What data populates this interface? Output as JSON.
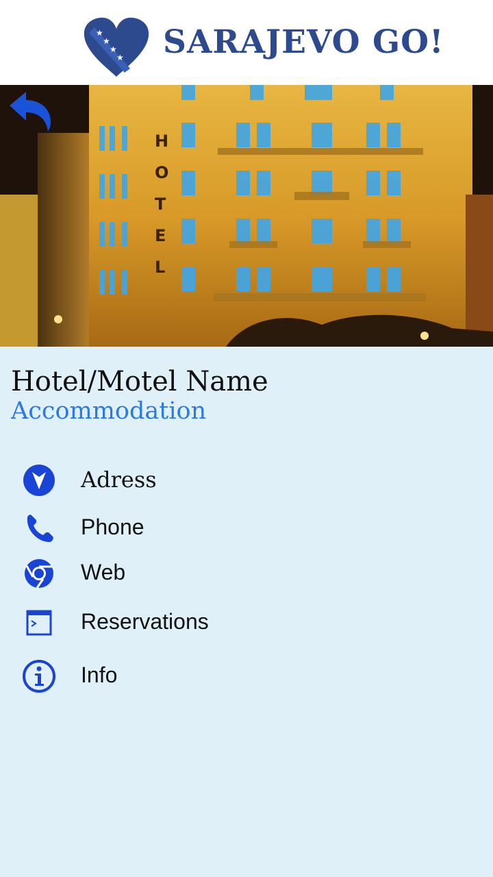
{
  "header": {
    "logo_text": "SARAJEVO GO!",
    "logo_icon": "heart-flag-icon",
    "brand_color": "#2e4a8f"
  },
  "photo": {
    "sign_letters": [
      "H",
      "O",
      "T",
      "E",
      "L"
    ]
  },
  "back_button": {
    "icon": "back-arrow-icon"
  },
  "listing": {
    "name": "Hotel/Motel Name",
    "category": "Accommodation"
  },
  "details": [
    {
      "label": "Adress",
      "icon": "location-arrow-icon"
    },
    {
      "label": "Phone",
      "icon": "phone-icon"
    },
    {
      "label": "Web",
      "icon": "chrome-icon"
    },
    {
      "label": "Reservations",
      "icon": "terminal-icon"
    },
    {
      "label": "Info",
      "icon": "info-icon"
    }
  ],
  "colors": {
    "accent": "#1a44d6",
    "subtitle": "#2a7ae0",
    "background": "#e0f0f8"
  }
}
